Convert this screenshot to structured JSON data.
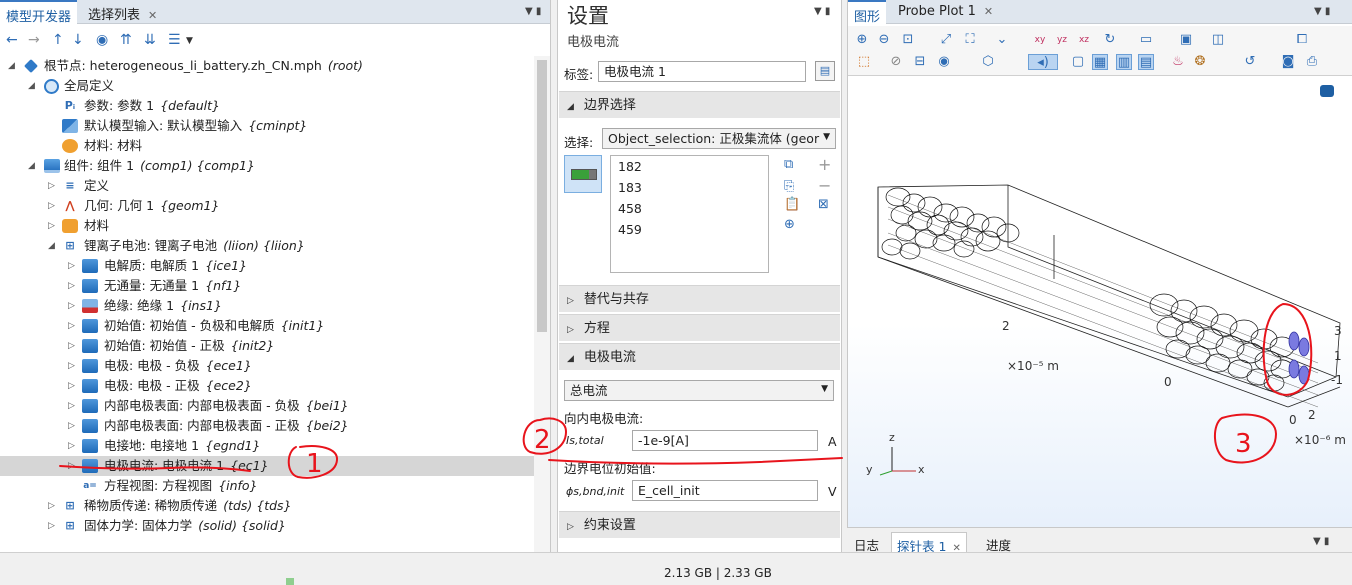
{
  "left_panel": {
    "tabs": [
      "模型开发器",
      "选择列表"
    ],
    "tree": [
      {
        "label": "根节点: heterogeneous_li_battery.zh_CN.mph",
        "tag": "(root)"
      },
      {
        "label": "全局定义",
        "tag": ""
      },
      {
        "label": "参数: 参数 1",
        "tag": "{default}"
      },
      {
        "label": "默认模型输入: 默认模型输入",
        "tag": "{cminpt}"
      },
      {
        "label": "材料: 材料",
        "tag": ""
      },
      {
        "label": "组件: 组件 1",
        "tag": "(comp1) {comp1}"
      },
      {
        "label": "定义",
        "tag": ""
      },
      {
        "label": "几何: 几何 1",
        "tag": "{geom1}"
      },
      {
        "label": "材料",
        "tag": ""
      },
      {
        "label": "锂离子电池: 锂离子电池",
        "tag": "(liion) {liion}"
      },
      {
        "label": "电解质: 电解质 1",
        "tag": "{ice1}"
      },
      {
        "label": "无通量: 无通量 1",
        "tag": "{nf1}"
      },
      {
        "label": "绝缘: 绝缘 1",
        "tag": "{ins1}"
      },
      {
        "label": "初始值: 初始值 - 负极和电解质",
        "tag": "{init1}"
      },
      {
        "label": "初始值: 初始值 - 正极",
        "tag": "{init2}"
      },
      {
        "label": "电极: 电极 - 负极",
        "tag": "{ece1}"
      },
      {
        "label": "电极: 电极 - 正极",
        "tag": "{ece2}"
      },
      {
        "label": "内部电极表面: 内部电极表面 - 负极",
        "tag": "{bei1}"
      },
      {
        "label": "内部电极表面: 内部电极表面 - 正极",
        "tag": "{bei2}"
      },
      {
        "label": "电接地: 电接地 1",
        "tag": "{egnd1}"
      },
      {
        "label": "电极电流: 电极电流 1",
        "tag": "{ec1}"
      },
      {
        "label": "方程视图: 方程视图",
        "tag": "{info}"
      },
      {
        "label": "稀物质传递: 稀物质传递",
        "tag": "(tds) {tds}"
      },
      {
        "label": "固体力学: 固体力学",
        "tag": "(solid) {solid}"
      }
    ]
  },
  "settings": {
    "title": "设置",
    "subtitle": "电极电流",
    "label_caption": "标签:",
    "label_value": "电极电流 1",
    "section_boundary": "边界选择",
    "selection_caption": "选择:",
    "selection_value": "Object_selection: 正极集流体 (geor",
    "boundaries": [
      "182",
      "183",
      "458",
      "459"
    ],
    "section_override": "替代与共存",
    "section_equation": "方程",
    "section_current": "电极电流",
    "current_type": "总电流",
    "inward_caption": "向内电极电流:",
    "current_symbol": "Is,total",
    "current_value": "-1e-9[A]",
    "current_unit": "A",
    "init_caption": "边界电位初始值:",
    "phi_symbol": "ϕs,bnd,init",
    "phi_value": "E_cell_init",
    "phi_unit": "V",
    "section_constraint": "约束设置"
  },
  "graphics": {
    "tabs": [
      "图形",
      "Probe Plot 1"
    ],
    "axis_x_main": "2",
    "axis_unit_main": "×10⁻⁵ m",
    "axis_zero": "0",
    "axis_y_0": "0",
    "axis_y_2": "2",
    "axis_unit_small": "×10⁻⁶ m",
    "axis_z_3": "3",
    "axis_z_1": "1",
    "axis_z_m1": "-1",
    "triad": {
      "z": "z",
      "y": "y",
      "x": "x"
    }
  },
  "bottom_tabs": [
    "日志",
    "探针表 1",
    "进度"
  ],
  "status": {
    "memory": "2.13 GB | 2.33 GB"
  },
  "annotations": [
    "1",
    "2",
    "3"
  ]
}
